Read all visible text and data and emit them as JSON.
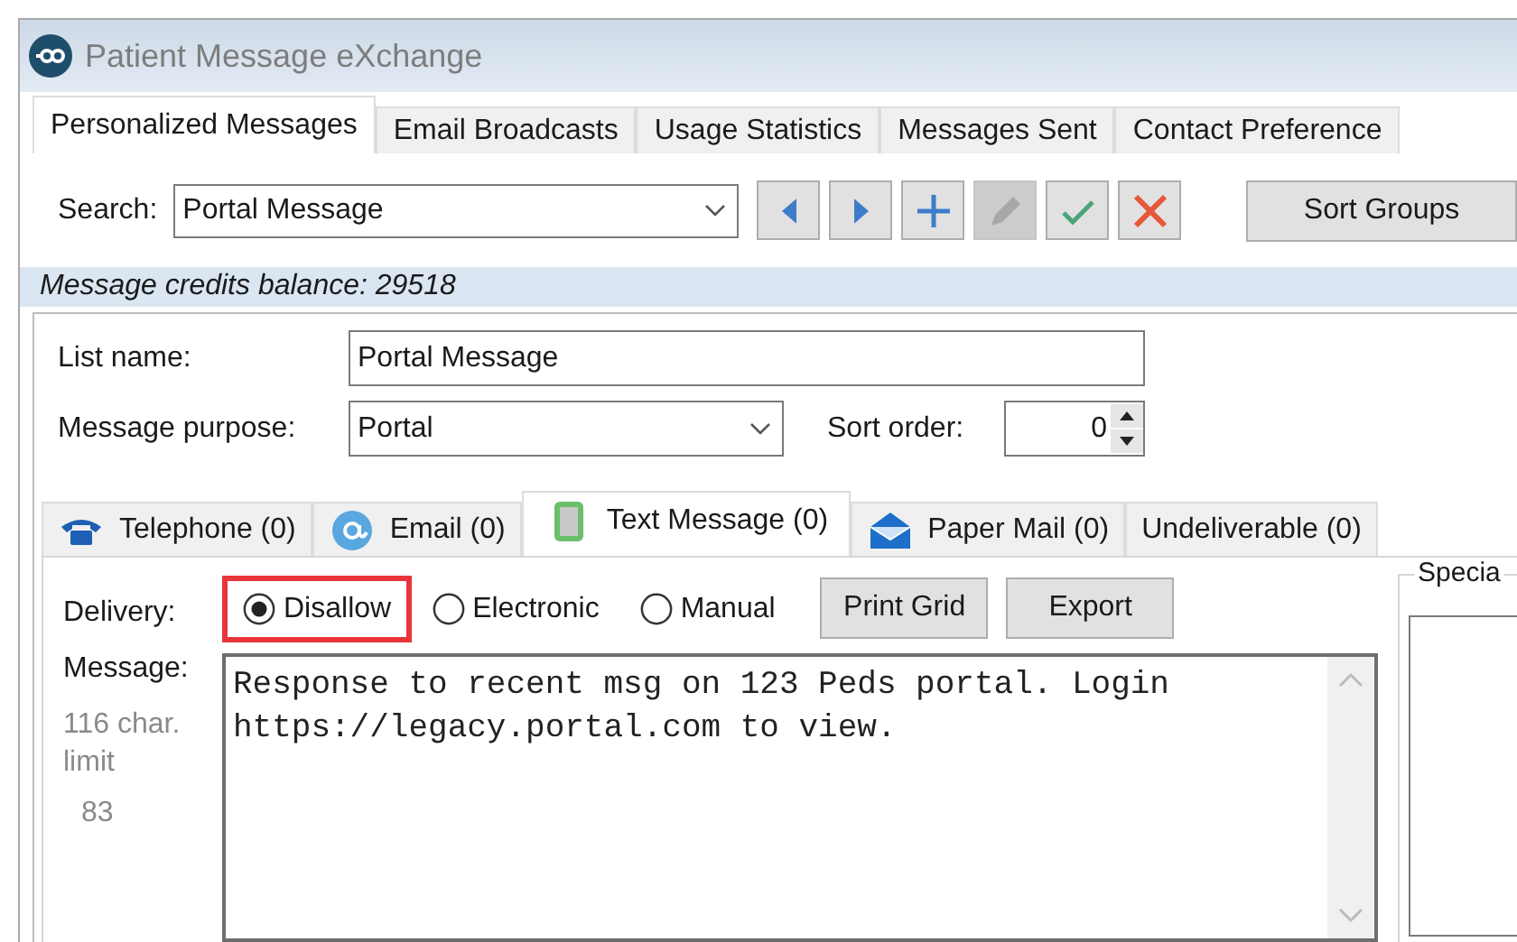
{
  "window": {
    "title": "Patient Message eXchange"
  },
  "tabs": [
    {
      "label": "Personalized Messages",
      "selected": true
    },
    {
      "label": "Email Broadcasts",
      "selected": false
    },
    {
      "label": "Usage Statistics",
      "selected": false
    },
    {
      "label": "Messages Sent",
      "selected": false
    },
    {
      "label": "Contact Preference",
      "selected": false
    }
  ],
  "search": {
    "label": "Search:",
    "value": "Portal Message"
  },
  "toolbar": [
    {
      "kind": "previous",
      "disabled": false
    },
    {
      "kind": "next",
      "disabled": false
    },
    {
      "kind": "add",
      "disabled": false
    },
    {
      "kind": "edit",
      "disabled": true
    },
    {
      "kind": "save",
      "disabled": false
    },
    {
      "kind": "delete",
      "disabled": false
    }
  ],
  "sort_groups_button": "Sort Groups",
  "credits": "Message credits balance: 29518",
  "list_name": {
    "label": "List name:",
    "value": "Portal Message"
  },
  "message_purpose": {
    "label": "Message purpose:",
    "value": "Portal"
  },
  "sort_order": {
    "label": "Sort order:",
    "value": "0"
  },
  "channel_tabs": [
    {
      "kind": "telephone",
      "label": "Telephone (0)",
      "selected": false
    },
    {
      "kind": "email",
      "label": "Email (0)",
      "selected": false
    },
    {
      "kind": "text",
      "label": "Text Message (0)",
      "selected": true
    },
    {
      "kind": "mail",
      "label": "Paper Mail (0)",
      "selected": false
    },
    {
      "kind": "plain",
      "label": "Undeliverable (0)",
      "selected": false
    }
  ],
  "delivery": {
    "label": "Delivery:",
    "options": [
      {
        "label": "Disallow",
        "selected": true,
        "highlighted": true
      },
      {
        "label": "Electronic",
        "selected": false,
        "highlighted": false
      },
      {
        "label": "Manual",
        "selected": false,
        "highlighted": false
      }
    ]
  },
  "buttons": [
    "Print Grid",
    "Export"
  ],
  "special_group": {
    "title": "Specia"
  },
  "message": {
    "label": "Message:",
    "limit": "116 char. limit",
    "remaining": "83",
    "value": "Response to recent msg on 123 Peds portal. Login https://legacy.portal.com to view."
  }
}
